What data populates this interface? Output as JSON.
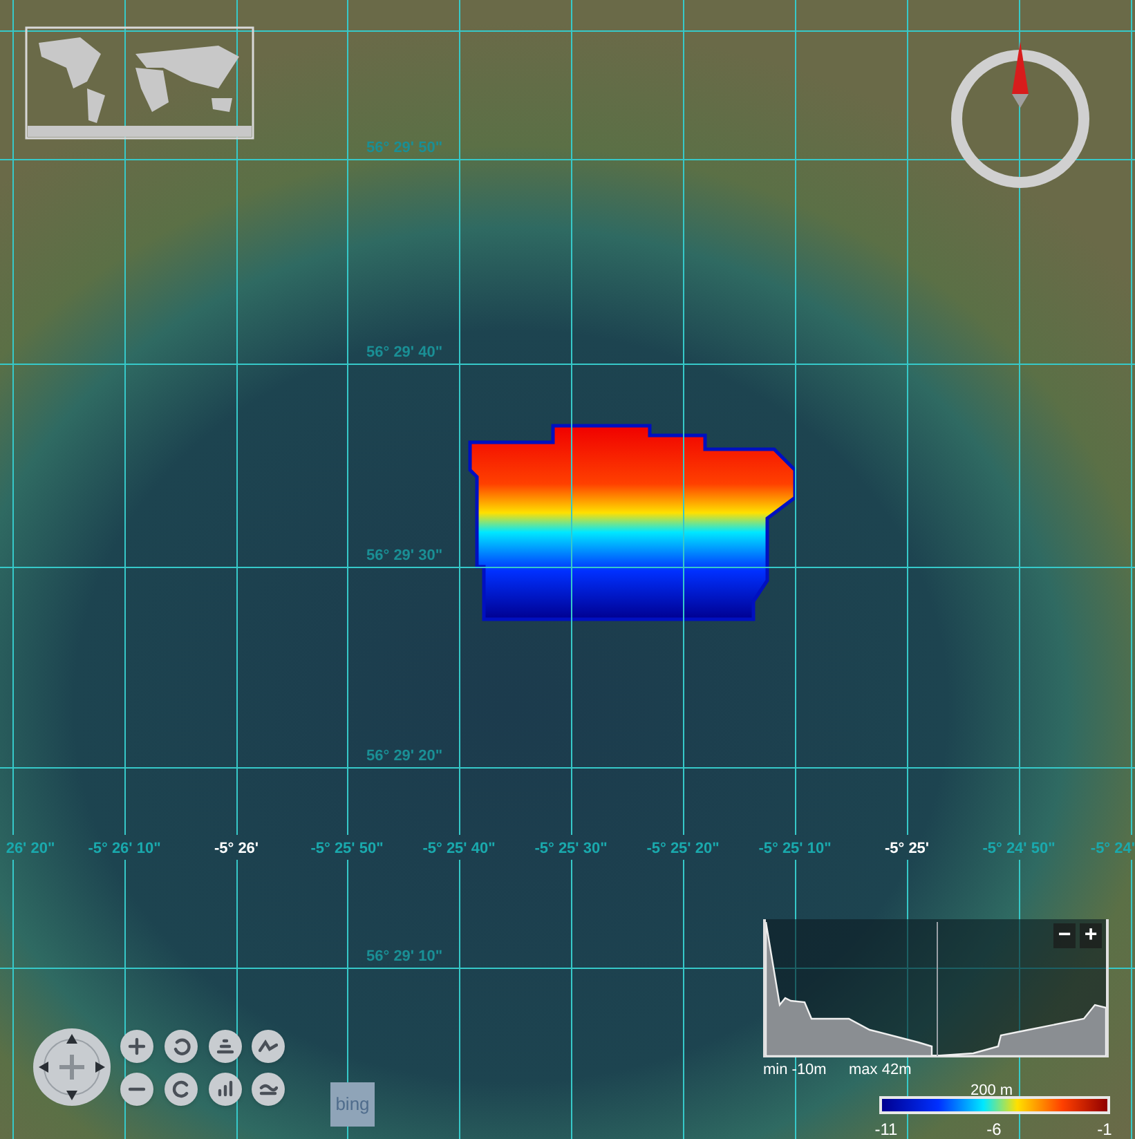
{
  "map": {
    "latitude_labels": [
      "56° 29' 50\"",
      "56° 29' 40\"",
      "56° 29' 30\"",
      "56° 29' 20\"",
      "56° 29' 10\""
    ],
    "longitude_labels": [
      {
        "text": "26' 20\"",
        "major": false
      },
      {
        "text": "-5° 26' 10\"",
        "major": false
      },
      {
        "text": "-5° 26'",
        "major": true
      },
      {
        "text": "-5° 25' 50\"",
        "major": false
      },
      {
        "text": "-5° 25' 40\"",
        "major": false
      },
      {
        "text": "-5° 25' 30\"",
        "major": false
      },
      {
        "text": "-5° 25' 20\"",
        "major": false
      },
      {
        "text": "-5° 25' 10\"",
        "major": false
      },
      {
        "text": "-5° 25'",
        "major": true
      },
      {
        "text": "-5° 24' 50\"",
        "major": false
      },
      {
        "text": "-5° 24'",
        "major": false
      }
    ],
    "attribution": "bing"
  },
  "profile": {
    "zoom_out": "−",
    "zoom_in": "+",
    "min": "min -10m",
    "max": "max 42m"
  },
  "legend": {
    "distance": "200 m",
    "ticks": [
      "-11",
      "-6",
      "-1"
    ]
  }
}
